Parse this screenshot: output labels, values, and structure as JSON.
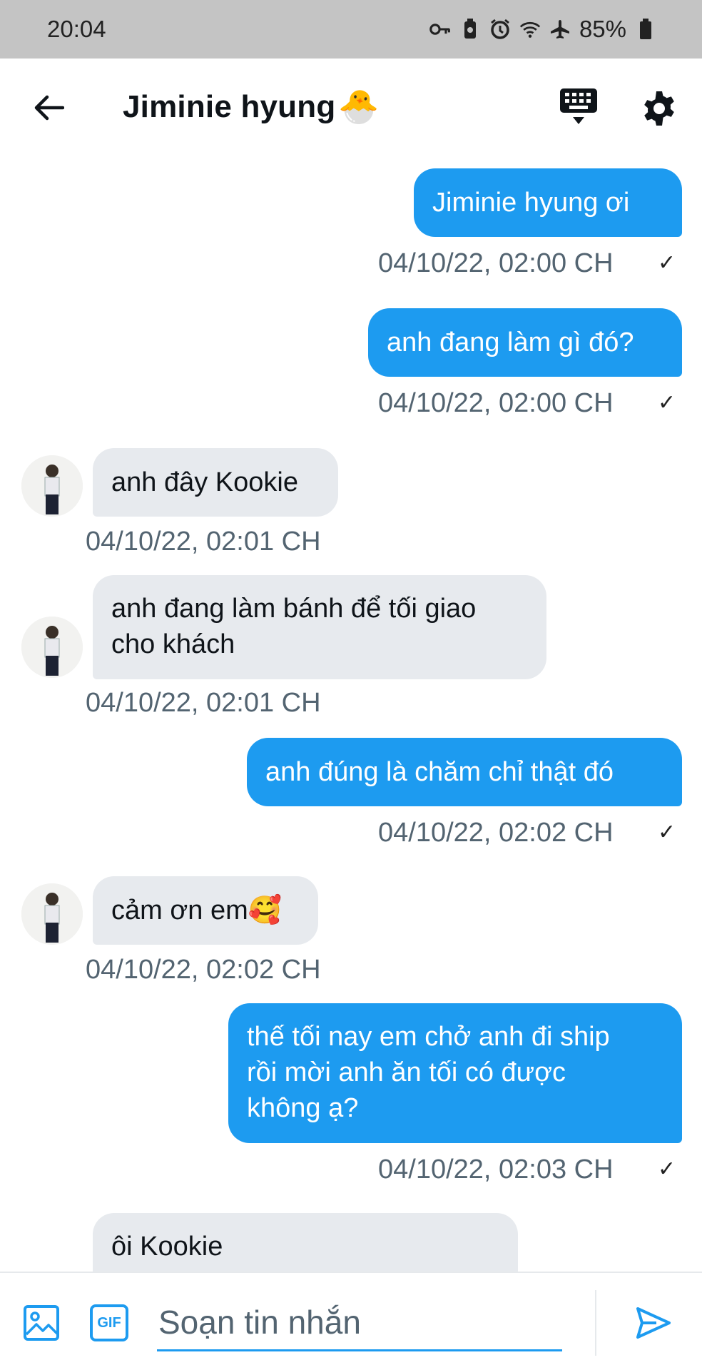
{
  "status_bar": {
    "time": "20:04",
    "battery": "85%"
  },
  "header": {
    "title": "Jiminie hyung",
    "title_emoji": "🐣"
  },
  "messages": [
    {
      "dir": "out",
      "lines": [
        "Jiminie hyung ơi"
      ],
      "time": "04/10/22, 02:00 CH"
    },
    {
      "dir": "out",
      "lines": [
        "anh đang làm gì đó?"
      ],
      "time": "04/10/22, 02:00 CH"
    },
    {
      "dir": "in",
      "lines": [
        "anh đây Kookie"
      ],
      "time": "04/10/22, 02:01 CH"
    },
    {
      "dir": "in",
      "lines": [
        "anh đang làm bánh để tối giao",
        "cho khách"
      ],
      "time": "04/10/22, 02:01 CH"
    },
    {
      "dir": "out",
      "lines": [
        "anh đúng là chăm chỉ thật đó"
      ],
      "time": "04/10/22, 02:02 CH"
    },
    {
      "dir": "in",
      "lines": [
        "cảm ơn em🥰"
      ],
      "time": "04/10/22, 02:02 CH"
    },
    {
      "dir": "out",
      "lines": [
        "thế tối nay em chở anh đi ship",
        "rồi mời anh ăn tối có được",
        "không ạ?"
      ],
      "time": "04/10/22, 02:03 CH"
    },
    {
      "dir": "in",
      "lines": [
        "ôi Kookie"
      ],
      "time": ""
    }
  ],
  "composer": {
    "placeholder": "Soạn tin nhắn",
    "gif_label": "GIF"
  },
  "colors": {
    "accent": "#1d9bf0",
    "incoming_bubble": "#e7eaee",
    "muted_text": "#536471"
  },
  "icons": {
    "back": "arrow-left-icon",
    "keyboard": "keyboard-icon",
    "settings": "gear-icon",
    "image": "image-icon",
    "gif": "gif-icon",
    "send": "send-icon"
  }
}
